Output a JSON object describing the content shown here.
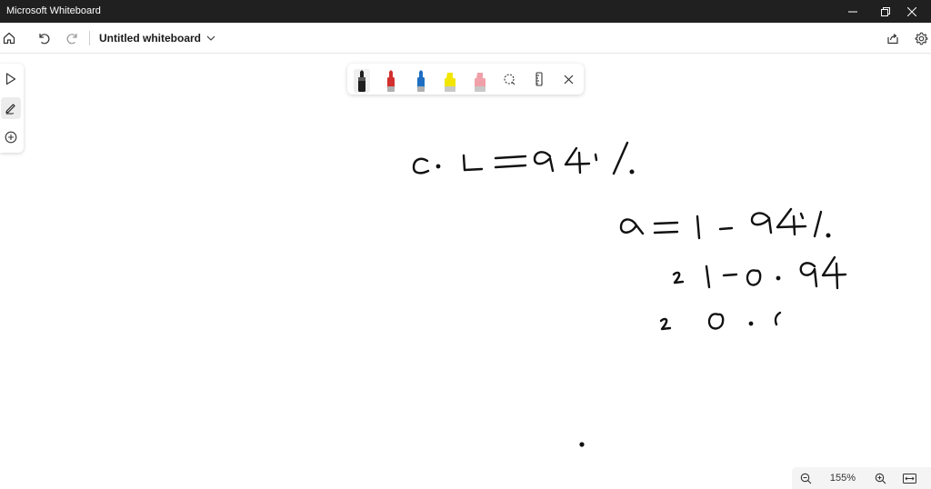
{
  "window": {
    "title": "Microsoft Whiteboard"
  },
  "appbar": {
    "document_title": "Untitled whiteboard"
  },
  "left_toolbar": {
    "items": [
      "select-icon",
      "pen-icon",
      "add-icon"
    ],
    "active": "pen-icon"
  },
  "pen_tray": {
    "pens": [
      {
        "name": "black-pen",
        "color": "#1e1e1e"
      },
      {
        "name": "red-pen",
        "color": "#d32f2f"
      },
      {
        "name": "blue-pen",
        "color": "#1e6fc2"
      },
      {
        "name": "yellow-highlighter",
        "color": "#f2e600"
      },
      {
        "name": "pink-highlighter",
        "color": "#f0a0a8"
      }
    ],
    "active_pen": "black-pen"
  },
  "zoom": {
    "level": "155%"
  },
  "colors": {
    "titlebar": "#202020",
    "ink": "#111111"
  }
}
